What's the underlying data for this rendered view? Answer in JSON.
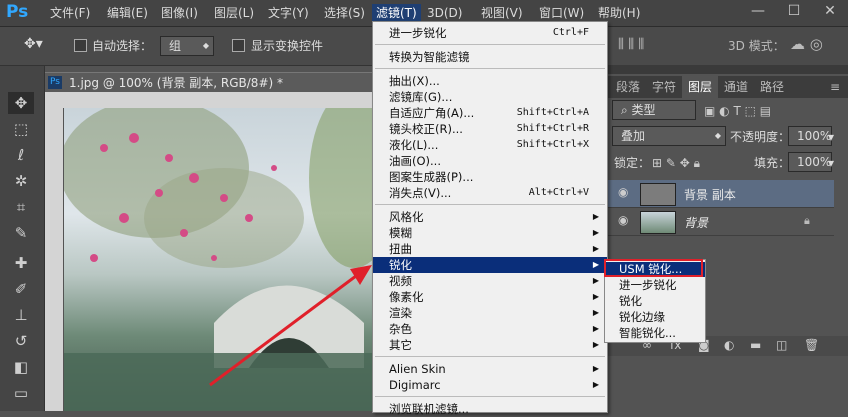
{
  "app": {
    "logo": "Ps"
  },
  "menubar": {
    "items": [
      "文件(F)",
      "编辑(E)",
      "图像(I)",
      "图层(L)",
      "文字(Y)",
      "选择(S)",
      "滤镜(T)",
      "3D(D)",
      "视图(V)",
      "窗口(W)",
      "帮助(H)"
    ],
    "active_index": 6,
    "window_controls": [
      "—",
      "☐",
      "✕"
    ]
  },
  "options_bar": {
    "auto_select_label": "自动选择：",
    "auto_select_value": "组",
    "show_transform_label": "显示变换控件",
    "mode_3d_label": "3D 模式："
  },
  "document": {
    "tab_title": "1.jpg @ 100% (背景 副本, RGB/8#) *",
    "tab_icon": "Ps"
  },
  "filter_menu": {
    "items": [
      {
        "label": "进一步锐化",
        "shortcut": "Ctrl+F"
      },
      {
        "sep": true
      },
      {
        "label": "转换为智能滤镜"
      },
      {
        "sep": true
      },
      {
        "label": "抽出(X)..."
      },
      {
        "label": "滤镜库(G)..."
      },
      {
        "label": "自适应广角(A)...",
        "shortcut": "Shift+Ctrl+A"
      },
      {
        "label": "镜头校正(R)...",
        "shortcut": "Shift+Ctrl+R"
      },
      {
        "label": "液化(L)...",
        "shortcut": "Shift+Ctrl+X"
      },
      {
        "label": "油画(O)..."
      },
      {
        "label": "图案生成器(P)..."
      },
      {
        "label": "消失点(V)...",
        "shortcut": "Alt+Ctrl+V"
      },
      {
        "sep": true
      },
      {
        "label": "风格化",
        "submenu": true
      },
      {
        "label": "模糊",
        "submenu": true
      },
      {
        "label": "扭曲",
        "submenu": true
      },
      {
        "label": "锐化",
        "submenu": true,
        "highlighted": true
      },
      {
        "label": "视频",
        "submenu": true
      },
      {
        "label": "像素化",
        "submenu": true
      },
      {
        "label": "渲染",
        "submenu": true
      },
      {
        "label": "杂色",
        "submenu": true
      },
      {
        "label": "其它",
        "submenu": true
      },
      {
        "sep": true
      },
      {
        "label": "Alien Skin",
        "submenu": true
      },
      {
        "label": "Digimarc",
        "submenu": true
      },
      {
        "sep": true
      },
      {
        "label": "浏览联机滤镜..."
      }
    ]
  },
  "sharpen_submenu": {
    "items": [
      {
        "label": "USM 锐化...",
        "highlighted": true
      },
      {
        "label": "进一步锐化"
      },
      {
        "label": "锐化"
      },
      {
        "label": "锐化边缘"
      },
      {
        "label": "智能锐化..."
      }
    ]
  },
  "panels": {
    "tabs": [
      "段落",
      "字符",
      "图层",
      "通道",
      "路径"
    ],
    "active_tab": 2,
    "filter_kind": "类型",
    "blend_mode": "叠加",
    "opacity_label": "不透明度：",
    "opacity_value": "100%",
    "lock_label": "锁定：",
    "fill_label": "填充：",
    "fill_value": "100%",
    "layers": [
      {
        "name": "背景 副本",
        "active": true
      },
      {
        "name": "背景",
        "active": false,
        "locked": true
      }
    ]
  },
  "colors": {
    "accent": "#0a2e7a",
    "highlight_box": "#e0202a",
    "arrow": "#e0202a"
  }
}
